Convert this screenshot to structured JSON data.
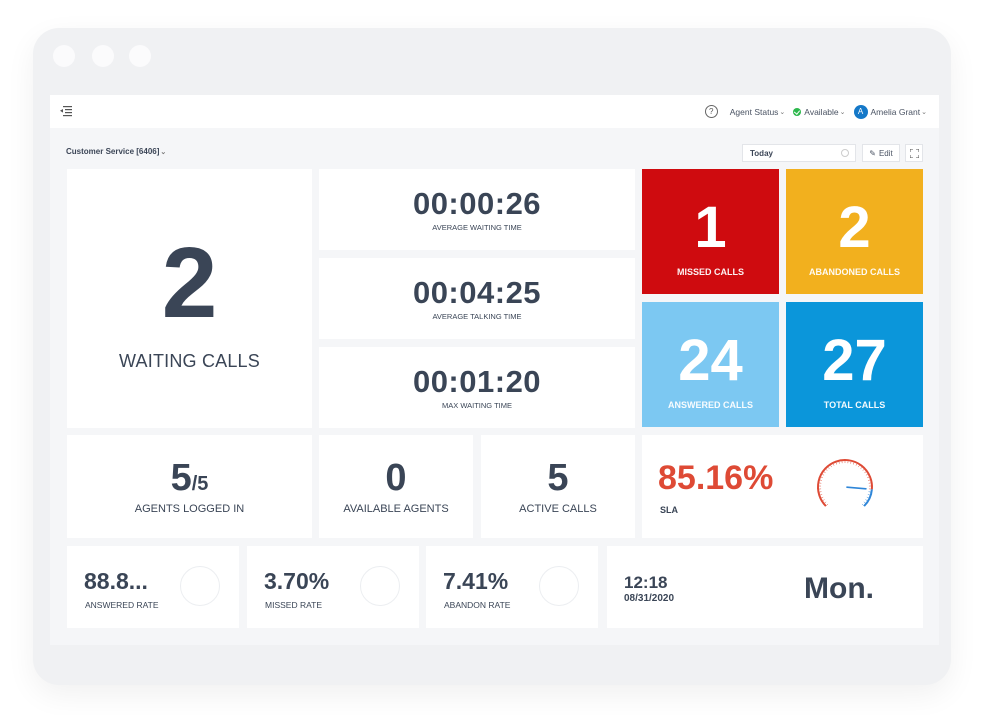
{
  "window": {
    "controls": [
      "close",
      "minimize",
      "maximize"
    ]
  },
  "topbar": {
    "menu_icon": "menu-collapse-icon",
    "help_icon": "question-circle-icon",
    "agent_status_label": "Agent Status",
    "availability_label": "Available",
    "availability_color": "#2db84d",
    "user_initial": "A",
    "user_name": "Amelia Grant"
  },
  "toolbar": {
    "queue_label": "Customer Service [6406]",
    "date_range_value": "Today",
    "edit_label": "Edit",
    "fullscreen_icon": "expand-icon"
  },
  "waiting": {
    "value": "2",
    "label": "WAITING CALLS"
  },
  "times": [
    {
      "value": "00:00:26",
      "label": "AVERAGE WAITING TIME"
    },
    {
      "value": "00:04:25",
      "label": "AVERAGE TALKING TIME"
    },
    {
      "value": "00:01:20",
      "label": "MAX WAITING TIME"
    }
  ],
  "tiles": {
    "missed": {
      "value": "1",
      "label": "MISSED CALLS",
      "color": "#cf0b0f"
    },
    "abandoned": {
      "value": "2",
      "label": "ABANDONED CALLS",
      "color": "#f2b01e"
    },
    "answered": {
      "value": "24",
      "label": "ANSWERED CALLS",
      "color": "#7cc8f2"
    },
    "total": {
      "value": "27",
      "label": "TOTAL CALLS",
      "color": "#0b96da"
    }
  },
  "agents": {
    "logged_in": "5",
    "logged_total": "/5",
    "logged_label": "AGENTS LOGGED IN",
    "available_value": "0",
    "available_label": "AVAILABLE AGENTS",
    "active_value": "5",
    "active_label": "ACTIVE CALLS"
  },
  "sla": {
    "value": "85.16%",
    "label": "SLA",
    "gauge_fraction": 0.8516,
    "color_primary": "#de4a35",
    "color_secondary": "#2f86d8"
  },
  "rates": [
    {
      "value": "88.8...",
      "label": "ANSWERED RATE"
    },
    {
      "value": "3.70%",
      "label": "MISSED RATE"
    },
    {
      "value": "7.41%",
      "label": "ABANDON RATE"
    }
  ],
  "datetime": {
    "time": "12:18",
    "date": "08/31/2020",
    "day": "Mon."
  }
}
